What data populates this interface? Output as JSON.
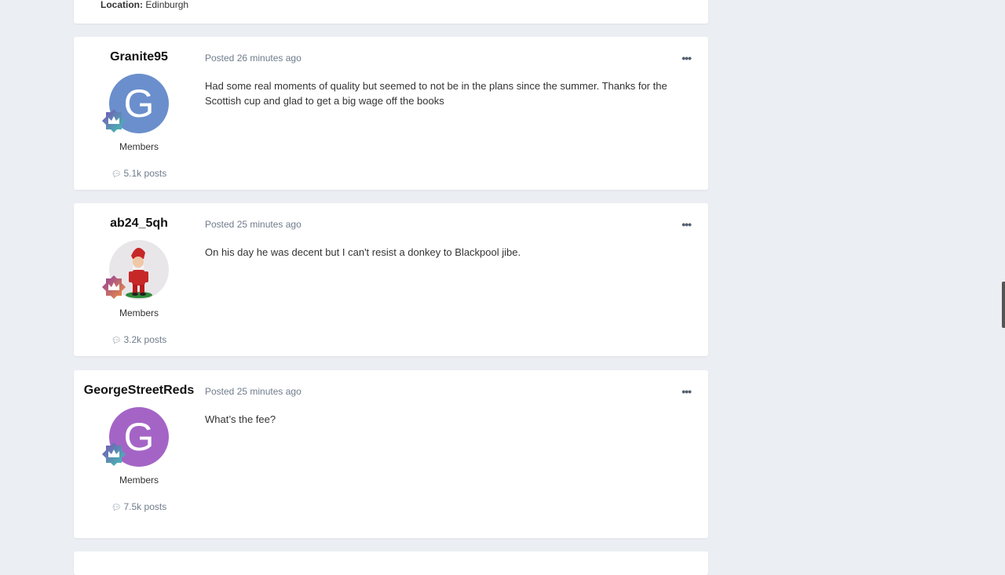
{
  "previous_post": {
    "location_label": "Location:",
    "location_value": "Edinburgh"
  },
  "posts": [
    {
      "username": "Granite95",
      "avatar_letter": "G",
      "avatar_color": "#6a8fcc",
      "group": "Members",
      "post_count": "5.1k posts",
      "posted": "Posted 26 minutes ago",
      "body": "Had some real moments of quality but seemed to not be in the plans since the summer. Thanks for the Scottish cup and glad to get a big wage off the books",
      "badge_color": "purple-teal"
    },
    {
      "username": "ab24_5qh",
      "avatar_letter": "",
      "avatar_color": "#e9e6ea",
      "group": "Members",
      "post_count": "3.2k posts",
      "posted": "Posted 25 minutes ago",
      "body": "On his day he was decent but I can't resist a donkey to Blackpool jibe.",
      "badge_color": "purple-orange"
    },
    {
      "username": "GeorgeStreetReds",
      "avatar_letter": "G",
      "avatar_color": "#a464c6",
      "group": "Members",
      "post_count": "7.5k posts",
      "posted": "Posted 25 minutes ago",
      "body": "What’s the fee?",
      "badge_color": "purple-teal"
    }
  ],
  "icons": {
    "menu": "ellipsis-icon",
    "posts": "comment-icon",
    "badge": "crown-badge-icon"
  }
}
